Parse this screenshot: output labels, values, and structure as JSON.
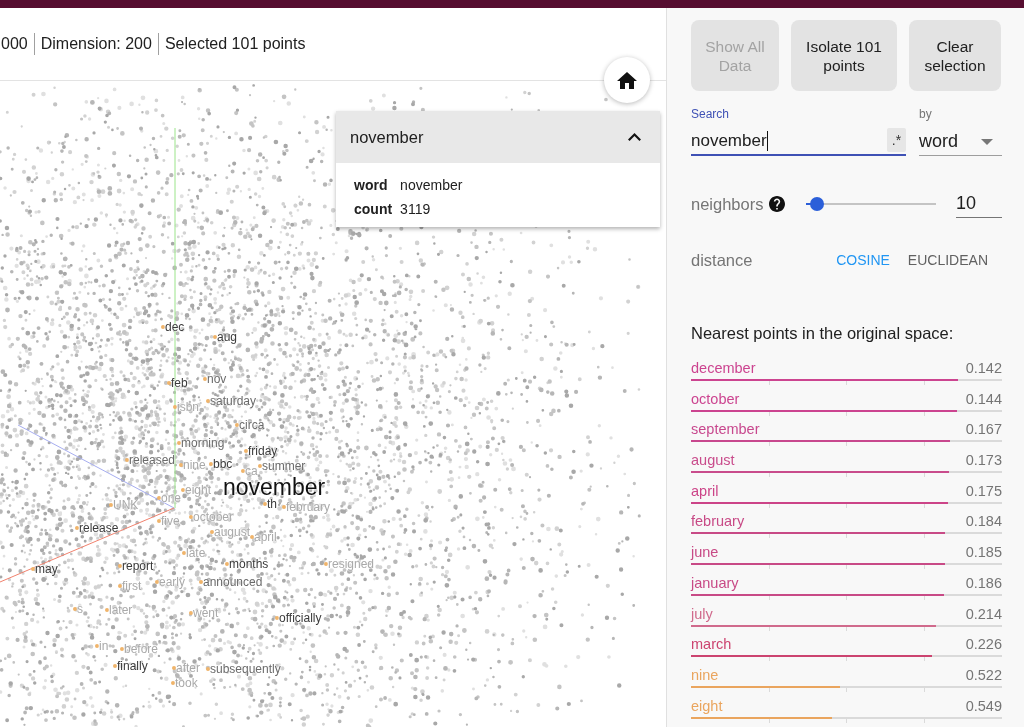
{
  "header": {
    "stats": [
      "000",
      "Dimension: 200",
      "Selected 101 points"
    ]
  },
  "projection": {
    "labels": [
      {
        "text": "dec",
        "kind": "neighbor"
      },
      {
        "text": "aug",
        "kind": "neighbor"
      },
      {
        "text": "feb",
        "kind": "neighbor"
      },
      {
        "text": "nov",
        "kind": "neighbor"
      },
      {
        "text": "isbn",
        "kind": "neighbor"
      },
      {
        "text": "saturday",
        "kind": "neighbor"
      },
      {
        "text": "circa",
        "kind": "neighbor"
      },
      {
        "text": "morning",
        "kind": "neighbor"
      },
      {
        "text": "friday",
        "kind": "neighbor"
      },
      {
        "text": "released",
        "kind": "neighbor"
      },
      {
        "text": "nine",
        "kind": "neighbor"
      },
      {
        "text": "bbc",
        "kind": "neighbor"
      },
      {
        "text": "ca",
        "kind": "neighbor"
      },
      {
        "text": "summer",
        "kind": "neighbor"
      },
      {
        "text": "eight",
        "kind": "neighbor"
      },
      {
        "text": "november",
        "kind": "selected"
      },
      {
        "text": "UNK",
        "kind": "neighbor"
      },
      {
        "text": "one",
        "kind": "neighbor"
      },
      {
        "text": "th",
        "kind": "neighbor"
      },
      {
        "text": "february",
        "kind": "neighbor"
      },
      {
        "text": "five",
        "kind": "neighbor"
      },
      {
        "text": "october",
        "kind": "neighbor"
      },
      {
        "text": "release",
        "kind": "neighbor"
      },
      {
        "text": "august",
        "kind": "neighbor"
      },
      {
        "text": "april",
        "kind": "neighbor"
      },
      {
        "text": "late",
        "kind": "neighbor"
      },
      {
        "text": "may",
        "kind": "neighbor"
      },
      {
        "text": "report",
        "kind": "neighbor"
      },
      {
        "text": "months",
        "kind": "neighbor"
      },
      {
        "text": "resigned",
        "kind": "neighbor"
      },
      {
        "text": "first",
        "kind": "neighbor"
      },
      {
        "text": "early",
        "kind": "neighbor"
      },
      {
        "text": "announced",
        "kind": "neighbor"
      },
      {
        "text": "s",
        "kind": "neighbor"
      },
      {
        "text": "later",
        "kind": "neighbor"
      },
      {
        "text": "went",
        "kind": "neighbor"
      },
      {
        "text": "officially",
        "kind": "neighbor"
      },
      {
        "text": "in",
        "kind": "neighbor"
      },
      {
        "text": "before",
        "kind": "neighbor"
      },
      {
        "text": "finally",
        "kind": "neighbor"
      },
      {
        "text": "after",
        "kind": "neighbor"
      },
      {
        "text": "subsequently",
        "kind": "neighbor"
      },
      {
        "text": "took",
        "kind": "neighbor"
      }
    ]
  },
  "info_card": {
    "title": "november",
    "expanded": true,
    "fields": [
      {
        "key": "word",
        "value": "november"
      },
      {
        "key": "count",
        "value": "3119"
      }
    ]
  },
  "controls": {
    "buttons": [
      {
        "label": "Show All Data",
        "disabled": true
      },
      {
        "label": "Isolate 101 points",
        "disabled": false
      },
      {
        "label": "Clear selection",
        "disabled": false
      }
    ],
    "search": {
      "label": "Search",
      "value": "november",
      "focused": true,
      "regex_toggle": ".*"
    },
    "search_by": {
      "label": "by",
      "value": "word"
    },
    "neighbors": {
      "label": "neighbors",
      "level": 0.085,
      "value": "10"
    },
    "distance": {
      "label": "distance",
      "options": [
        {
          "label": "COSINE",
          "selected": true
        },
        {
          "label": "EUCLIDEAN",
          "selected": false
        }
      ]
    }
  },
  "nearest": {
    "title": "Nearest points in the original space:",
    "items": [
      {
        "word": "december",
        "distance": "0.142",
        "level": 0.857,
        "color": "#cc4490"
      },
      {
        "word": "october",
        "distance": "0.144",
        "level": 0.856,
        "color": "#cc4490"
      },
      {
        "word": "september",
        "distance": "0.167",
        "level": 0.834,
        "color": "#c8488e"
      },
      {
        "word": "august",
        "distance": "0.173",
        "level": 0.829,
        "color": "#c94c8c"
      },
      {
        "word": "april",
        "distance": "0.175",
        "level": 0.826,
        "color": "#cc4488"
      },
      {
        "word": "february",
        "distance": "0.184",
        "level": 0.816,
        "color": "#c84a86"
      },
      {
        "word": "june",
        "distance": "0.185",
        "level": 0.816,
        "color": "#c84a86"
      },
      {
        "word": "january",
        "distance": "0.186",
        "level": 0.813,
        "color": "#c84a86"
      },
      {
        "word": "july",
        "distance": "0.214",
        "level": 0.788,
        "color": "#d06a8c"
      },
      {
        "word": "march",
        "distance": "0.226",
        "level": 0.776,
        "color": "#cc4470"
      },
      {
        "word": "nine",
        "distance": "0.522",
        "level": 0.48,
        "color": "#eaa55e"
      },
      {
        "word": "eight",
        "distance": "0.549",
        "level": 0.452,
        "color": "#eaa55e"
      }
    ]
  }
}
